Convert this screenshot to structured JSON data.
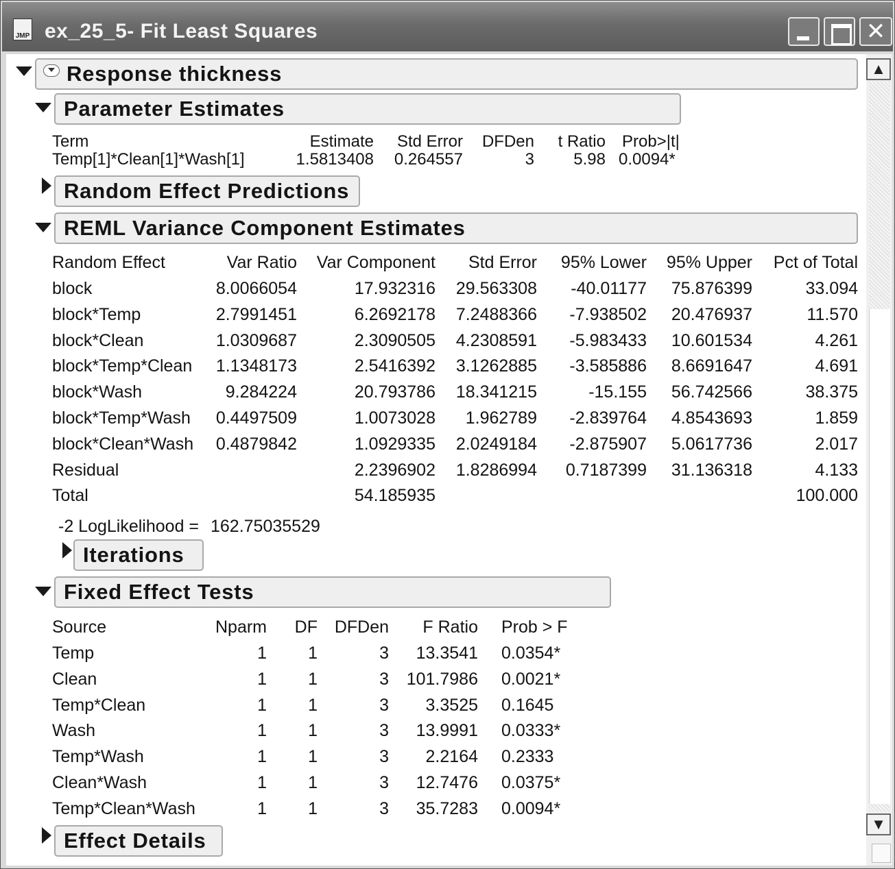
{
  "window": {
    "title": "ex_25_5- Fit Least Squares",
    "icon_text": "JMP",
    "icon": "jmp-file-icon"
  },
  "response": {
    "label": "Response thickness"
  },
  "parameter_estimates": {
    "title": "Parameter Estimates",
    "headers": [
      "Term",
      "Estimate",
      "Std Error",
      "DFDen",
      "t Ratio",
      "Prob>|t|"
    ],
    "rows": [
      [
        "Temp[1]*Clean[1]*Wash[1]",
        "1.5813408",
        "0.264557",
        "3",
        "5.98",
        "0.0094*"
      ]
    ]
  },
  "random_effect_predictions": {
    "title": "Random Effect Predictions"
  },
  "reml": {
    "title": "REML Variance Component Estimates",
    "headers": [
      "Random Effect",
      "Var Ratio",
      "Var Component",
      "Std Error",
      "95% Lower",
      "95% Upper",
      "Pct of Total"
    ],
    "rows": [
      [
        "block",
        "8.0066054",
        "17.932316",
        "29.563308",
        "-40.01177",
        "75.876399",
        "33.094"
      ],
      [
        "block*Temp",
        "2.7991451",
        "6.2692178",
        "7.2488366",
        "-7.938502",
        "20.476937",
        "11.570"
      ],
      [
        "block*Clean",
        "1.0309687",
        "2.3090505",
        "4.2308591",
        "-5.983433",
        "10.601534",
        "4.261"
      ],
      [
        "block*Temp*Clean",
        "1.1348173",
        "2.5416392",
        "3.1262885",
        "-3.585886",
        "8.6691647",
        "4.691"
      ],
      [
        "block*Wash",
        "9.284224",
        "20.793786",
        "18.341215",
        "-15.155",
        "56.742566",
        "38.375"
      ],
      [
        "block*Temp*Wash",
        "0.4497509",
        "1.0073028",
        "1.962789",
        "-2.839764",
        "4.8543693",
        "1.859"
      ],
      [
        "block*Clean*Wash",
        "0.4879842",
        "1.0929335",
        "2.0249184",
        "-2.875907",
        "5.0617736",
        "2.017"
      ],
      [
        "Residual",
        "",
        "2.2396902",
        "1.8286994",
        "0.7187399",
        "31.136318",
        "4.133"
      ],
      [
        "Total",
        "",
        "54.185935",
        "",
        "",
        "",
        "100.000"
      ]
    ],
    "loglik_label": "-2 LogLikelihood =",
    "loglik_value": "162.75035529"
  },
  "iterations": {
    "title": "Iterations"
  },
  "fixed_effect_tests": {
    "title": "Fixed Effect Tests",
    "headers": [
      "Source",
      "Nparm",
      "DF",
      "DFDen",
      "F Ratio",
      "Prob > F"
    ],
    "rows": [
      [
        "Temp",
        "1",
        "1",
        "3",
        "13.3541",
        "0.0354*"
      ],
      [
        "Clean",
        "1",
        "1",
        "3",
        "101.7986",
        "0.0021*"
      ],
      [
        "Temp*Clean",
        "1",
        "1",
        "3",
        "3.3525",
        "0.1645"
      ],
      [
        "Wash",
        "1",
        "1",
        "3",
        "13.9991",
        "0.0333*"
      ],
      [
        "Temp*Wash",
        "1",
        "1",
        "3",
        "2.2164",
        "0.2333"
      ],
      [
        "Clean*Wash",
        "1",
        "1",
        "3",
        "12.7476",
        "0.0375*"
      ],
      [
        "Temp*Clean*Wash",
        "1",
        "1",
        "3",
        "35.7283",
        "0.0094*"
      ]
    ]
  },
  "effect_details": {
    "title": "Effect Details"
  },
  "icons": [
    "disclosure-open-icon",
    "disclosure-closed-icon",
    "minimize-icon",
    "maximize-icon",
    "close-icon",
    "scroll-up-icon",
    "scroll-down-icon"
  ]
}
